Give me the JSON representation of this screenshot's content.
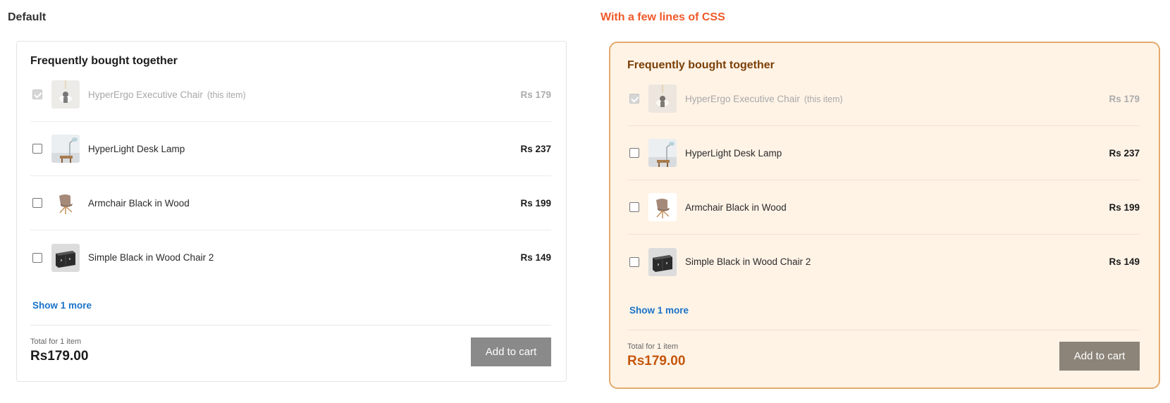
{
  "sections": {
    "default_title": "Default",
    "styled_title": "With a few lines of CSS",
    "styled_title_color": "#f0592a"
  },
  "widget": {
    "heading": "Frequently bought together",
    "items": [
      {
        "name": "HyperErgo Executive Chair",
        "note": "(this item)",
        "price": "Rs 179",
        "checked": true,
        "disabled": true,
        "thumb": "chair-pendant-thumbnail"
      },
      {
        "name": "HyperLight Desk Lamp",
        "price": "Rs 237",
        "checked": false,
        "thumb": "desk-lamp-thumbnail"
      },
      {
        "name": "Armchair Black in Wood",
        "price": "Rs 199",
        "checked": false,
        "thumb": "armchair-thumbnail"
      },
      {
        "name": "Simple Black in Wood Chair 2",
        "price": "Rs 149",
        "checked": false,
        "thumb": "black-cabinet-thumbnail"
      }
    ],
    "show_more": "Show 1 more",
    "total_label": "Total for 1 item",
    "total_value": "Rs179.00",
    "add_to_cart": "Add to cart"
  },
  "colors": {
    "styled_background": "#fff3e6",
    "styled_border": "#e3aa6e",
    "styled_total": "#c4560c",
    "link": "#1a73c8",
    "button_default": "#8a8a8a",
    "button_styled": "#8c8479"
  }
}
